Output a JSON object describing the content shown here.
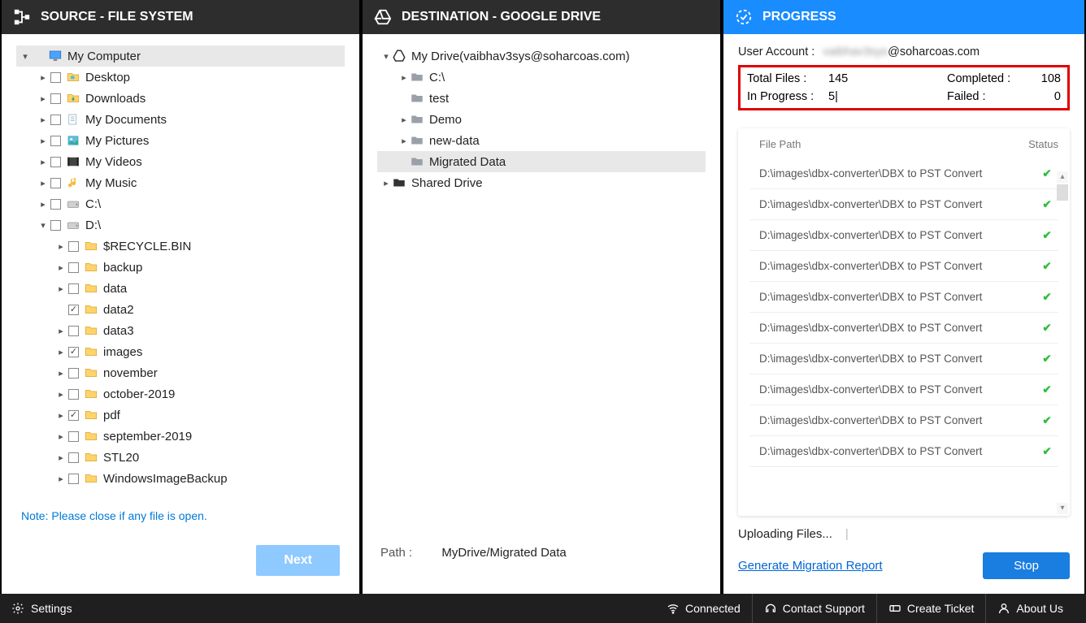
{
  "source": {
    "title": "SOURCE - FILE SYSTEM",
    "note": "Note: Please close if any file is open.",
    "next_label": "Next",
    "tree": [
      {
        "depth": 0,
        "exp": "▾",
        "chk": false,
        "icon": "monitor",
        "label": "My Computer",
        "sel": true,
        "nochk": true
      },
      {
        "depth": 1,
        "exp": "▸",
        "chk": false,
        "icon": "folder-special",
        "label": "Desktop"
      },
      {
        "depth": 1,
        "exp": "▸",
        "chk": false,
        "icon": "folder-down",
        "label": "Downloads"
      },
      {
        "depth": 1,
        "exp": "▸",
        "chk": false,
        "icon": "folder-doc",
        "label": "My Documents"
      },
      {
        "depth": 1,
        "exp": "▸",
        "chk": false,
        "icon": "folder-pic",
        "label": "My Pictures"
      },
      {
        "depth": 1,
        "exp": "▸",
        "chk": false,
        "icon": "folder-vid",
        "label": "My Videos"
      },
      {
        "depth": 1,
        "exp": "▸",
        "chk": false,
        "icon": "folder-music",
        "label": "My Music"
      },
      {
        "depth": 1,
        "exp": "▸",
        "chk": false,
        "icon": "disk",
        "label": "C:\\"
      },
      {
        "depth": 1,
        "exp": "▾",
        "chk": false,
        "icon": "disk",
        "label": "D:\\"
      },
      {
        "depth": 2,
        "exp": "▸",
        "chk": false,
        "icon": "folder",
        "label": "$RECYCLE.BIN"
      },
      {
        "depth": 2,
        "exp": "▸",
        "chk": false,
        "icon": "folder",
        "label": "backup"
      },
      {
        "depth": 2,
        "exp": "▸",
        "chk": false,
        "icon": "folder",
        "label": "data"
      },
      {
        "depth": 2,
        "exp": "",
        "chk": true,
        "icon": "folder",
        "label": "data2"
      },
      {
        "depth": 2,
        "exp": "▸",
        "chk": false,
        "icon": "folder",
        "label": "data3"
      },
      {
        "depth": 2,
        "exp": "▸",
        "chk": true,
        "icon": "folder",
        "label": "images"
      },
      {
        "depth": 2,
        "exp": "▸",
        "chk": false,
        "icon": "folder",
        "label": "november"
      },
      {
        "depth": 2,
        "exp": "▸",
        "chk": false,
        "icon": "folder",
        "label": "october-2019"
      },
      {
        "depth": 2,
        "exp": "▸",
        "chk": true,
        "icon": "folder",
        "label": "pdf"
      },
      {
        "depth": 2,
        "exp": "▸",
        "chk": false,
        "icon": "folder",
        "label": "september-2019"
      },
      {
        "depth": 2,
        "exp": "▸",
        "chk": false,
        "icon": "folder",
        "label": "STL20"
      },
      {
        "depth": 2,
        "exp": "▸",
        "chk": false,
        "icon": "folder",
        "label": "WindowsImageBackup"
      }
    ]
  },
  "dest": {
    "title": "DESTINATION - GOOGLE DRIVE",
    "path_label": "Path :",
    "path_value": "MyDrive/Migrated Data",
    "tree": [
      {
        "depth": 0,
        "exp": "▾",
        "icon": "gdrive",
        "label": "My Drive(vaibhav3sys@soharcoas.com)"
      },
      {
        "depth": 1,
        "exp": "▸",
        "icon": "gfolder",
        "label": "C:\\"
      },
      {
        "depth": 1,
        "exp": "",
        "icon": "gfolder",
        "label": "test"
      },
      {
        "depth": 1,
        "exp": "▸",
        "icon": "gfolder",
        "label": "Demo"
      },
      {
        "depth": 1,
        "exp": "▸",
        "icon": "gfolder",
        "label": "new-data"
      },
      {
        "depth": 1,
        "exp": "",
        "icon": "gfolder",
        "label": "Migrated Data",
        "sel": true
      },
      {
        "depth": 0,
        "exp": "▸",
        "icon": "shared",
        "label": "Shared Drive"
      }
    ]
  },
  "progress": {
    "title": "PROGRESS",
    "account_label": "User Account :",
    "account_blur": "vaibhav3sys",
    "account_domain": "@soharcoas.com",
    "stats": {
      "total_label": "Total Files :",
      "total": "145",
      "completed_label": "Completed :",
      "completed": "108",
      "inprogress_label": "In Progress :",
      "inprogress": "5|",
      "failed_label": "Failed :",
      "failed": "0"
    },
    "col_filepath": "File Path",
    "col_status": "Status",
    "rows": [
      "D:\\images\\dbx-converter\\DBX to PST Convert",
      "D:\\images\\dbx-converter\\DBX to PST Convert",
      "D:\\images\\dbx-converter\\DBX to PST Convert",
      "D:\\images\\dbx-converter\\DBX to PST Convert",
      "D:\\images\\dbx-converter\\DBX to PST Convert",
      "D:\\images\\dbx-converter\\DBX to PST Convert",
      "D:\\images\\dbx-converter\\DBX to PST Convert",
      "D:\\images\\dbx-converter\\DBX to PST Convert",
      "D:\\images\\dbx-converter\\DBX to PST Convert",
      "D:\\images\\dbx-converter\\DBX to PST Convert"
    ],
    "uploading": "Uploading Files...",
    "gen_report": "Generate Migration Report",
    "stop": "Stop"
  },
  "footer": {
    "settings": "Settings",
    "connected": "Connected",
    "contact": "Contact Support",
    "ticket": "Create Ticket",
    "about": "About Us"
  }
}
